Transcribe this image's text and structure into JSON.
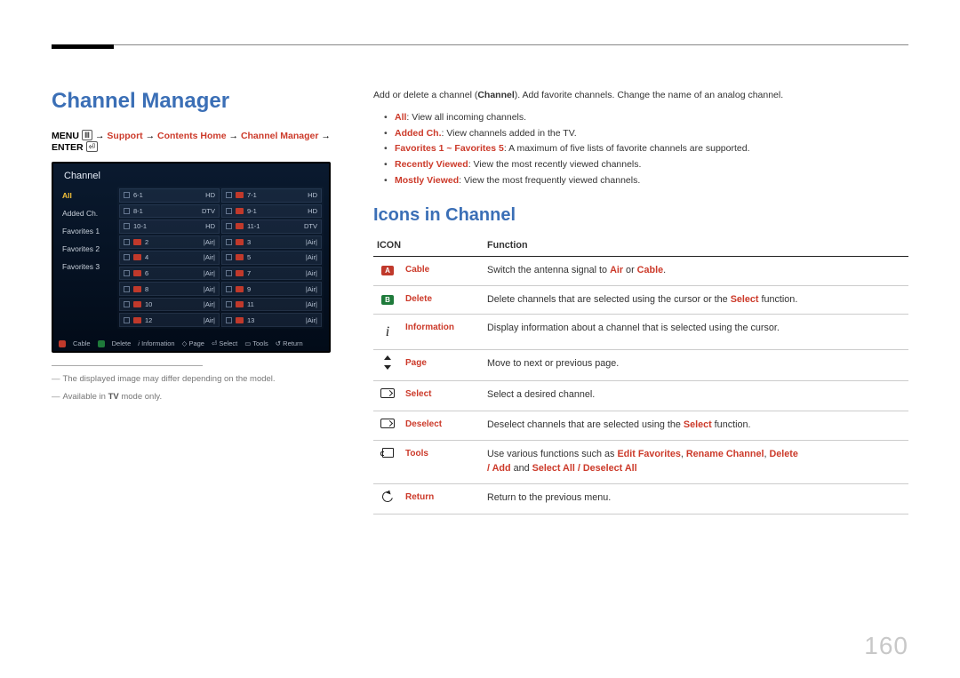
{
  "page_number": "160",
  "title": "Channel Manager",
  "breadcrumb": {
    "menu": "MENU",
    "arrow": "→",
    "p1": "Support",
    "p2": "Contents Home",
    "p3": "Channel Manager",
    "enter": "ENTER"
  },
  "tv": {
    "header": "Channel",
    "side": [
      "All",
      "Added Ch.",
      "Favorites 1",
      "Favorites 2",
      "Favorites 3"
    ],
    "cells": [
      {
        "n": "6-1",
        "t": "HD"
      },
      {
        "n": "7-1",
        "t": "HD",
        "a": true
      },
      {
        "n": "8-1",
        "t": "DTV"
      },
      {
        "n": "9-1",
        "t": "HD",
        "a": true
      },
      {
        "n": "10-1",
        "t": "HD"
      },
      {
        "n": "11-1",
        "t": "DTV",
        "a": true
      },
      {
        "n": "2",
        "t": "|Air|",
        "a": true
      },
      {
        "n": "3",
        "t": "|Air|",
        "a": true
      },
      {
        "n": "4",
        "t": "|Air|",
        "a": true
      },
      {
        "n": "5",
        "t": "|Air|",
        "a": true
      },
      {
        "n": "6",
        "t": "|Air|",
        "a": true
      },
      {
        "n": "7",
        "t": "|Air|",
        "a": true
      },
      {
        "n": "8",
        "t": "|Air|",
        "a": true
      },
      {
        "n": "9",
        "t": "|Air|",
        "a": true
      },
      {
        "n": "10",
        "t": "|Air|",
        "a": true
      },
      {
        "n": "11",
        "t": "|Air|",
        "a": true
      },
      {
        "n": "12",
        "t": "|Air|",
        "a": true
      },
      {
        "n": "13",
        "t": "|Air|",
        "a": true
      }
    ],
    "footer": {
      "cable": "Cable",
      "delete": "Delete",
      "info": "Information",
      "page": "Page",
      "select": "Select",
      "tools": "Tools",
      "return": "Return"
    }
  },
  "footnotes": {
    "f1_pre": "The displayed image may differ depending on the model.",
    "f2_pre": "Available in ",
    "f2_b": "TV",
    "f2_post": " mode only."
  },
  "intro": {
    "pre": "Add or delete a channel (",
    "bold": "Channel",
    "post": "). Add favorite channels. Change the name of an analog channel."
  },
  "bullets": [
    {
      "b": "All",
      "t": ": View all incoming channels."
    },
    {
      "b": "Added Ch.",
      "t": ": View channels added in the TV."
    },
    {
      "b": "Favorites 1 ~ Favorites 5",
      "t": ": A maximum of five lists of favorite channels are supported."
    },
    {
      "b": "Recently Viewed",
      "t": ": View the most recently viewed channels."
    },
    {
      "b": "Mostly Viewed",
      "t": ": View the most frequently viewed channels."
    }
  ],
  "subheading": "Icons in Channel",
  "table": {
    "h1": "ICON",
    "h2": "Function",
    "rows": {
      "cable": {
        "label": "Cable",
        "pre": "Switch the antenna signal to ",
        "r1": "Air",
        "mid": " or ",
        "r2": "Cable",
        "post": "."
      },
      "delete": {
        "label": "Delete",
        "pre": "Delete channels that are selected using the cursor or the ",
        "r1": "Select",
        "post": " function."
      },
      "info": {
        "label": "Information",
        "t": "Display information about a channel that is selected using the cursor."
      },
      "page": {
        "label": "Page",
        "t": "Move to next or previous page."
      },
      "select": {
        "label": "Select",
        "t": "Select a desired channel."
      },
      "deselect": {
        "label": "Deselect",
        "pre": "Deselect channels that are selected using the ",
        "r1": "Select",
        "post": " function."
      },
      "tools": {
        "label": "Tools",
        "pre": "Use various functions such as ",
        "r1": "Edit Favorites",
        "c1": ", ",
        "r2": "Rename Channel",
        "c2": ", ",
        "r3": "Delete",
        "line2a": " / ",
        "r4": "Add",
        "line2b": " and ",
        "r5": "Select All",
        "line2c": " / ",
        "r6": "Deselect All"
      },
      "return": {
        "label": "Return",
        "t": "Return to the previous menu."
      }
    }
  }
}
